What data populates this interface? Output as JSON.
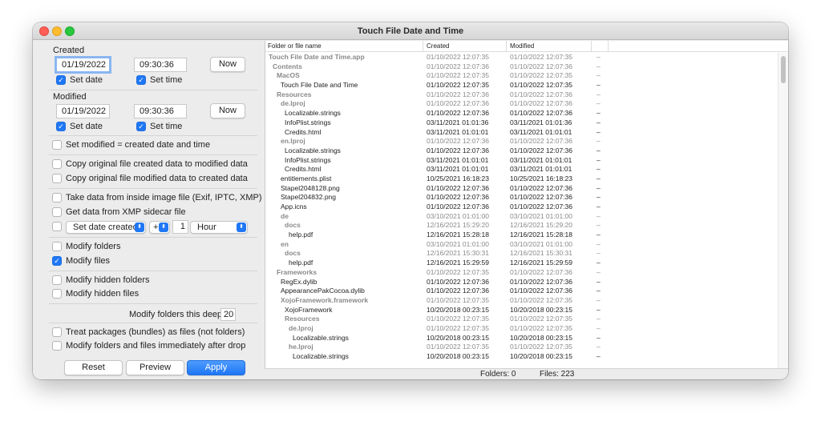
{
  "window": {
    "title": "Touch File Date and Time"
  },
  "created": {
    "label": "Created",
    "date": "01/19/2022",
    "time": "09:30:36",
    "now_label": "Now",
    "set_date_label": "Set date",
    "set_time_label": "Set time"
  },
  "modified": {
    "label": "Modified",
    "date": "01/19/2022",
    "time": "09:30:36",
    "now_label": "Now",
    "set_date_label": "Set date",
    "set_time_label": "Set time"
  },
  "options": {
    "set_mod_eq_created": "Set modified = created date and time",
    "copy_created_to_mod": "Copy original file created data to modified data",
    "copy_mod_to_created": "Copy original file modified data to created data",
    "take_from_image": "Take data from inside image file (Exif, IPTC, XMP)",
    "get_from_xmp": "Get data from XMP sidecar file",
    "offset_mode": "Set date created",
    "offset_sign": "+",
    "offset_amount": "1",
    "offset_unit": "Hour",
    "modify_folders": "Modify folders",
    "modify_files": "Modify files",
    "modify_hidden_folders": "Modify hidden folders",
    "modify_hidden_files": "Modify hidden files",
    "depth_label": "Modify folders this deep:",
    "depth_value": "20",
    "treat_packages": "Treat packages (bundles) as files (not folders)",
    "modify_after_drop": "Modify folders and files immediately after drop"
  },
  "buttons": {
    "reset": "Reset",
    "preview": "Preview",
    "apply": "Apply"
  },
  "table": {
    "headers": [
      "Folder or file name",
      "Created",
      "Modified"
    ],
    "rows": [
      [
        "Touch File Date and Time.app",
        "01/10/2022  12:07:35",
        "01/10/2022  12:07:35",
        "dim folder",
        0
      ],
      [
        "Contents",
        "01/10/2022  12:07:36",
        "01/10/2022  12:07:36",
        "dim folder",
        1
      ],
      [
        "MacOS",
        "01/10/2022  12:07:35",
        "01/10/2022  12:07:35",
        "dim folder",
        2
      ],
      [
        "Touch File Date and Time",
        "01/10/2022  12:07:35",
        "01/10/2022  12:07:35",
        "",
        3
      ],
      [
        "Resources",
        "01/10/2022  12:07:36",
        "01/10/2022  12:07:36",
        "dim folder",
        2
      ],
      [
        "de.lproj",
        "01/10/2022  12:07:36",
        "01/10/2022  12:07:36",
        "dim folder",
        3
      ],
      [
        "Localizable.strings",
        "01/10/2022  12:07:36",
        "01/10/2022  12:07:36",
        "",
        4
      ],
      [
        "InfoPlist.strings",
        "03/11/2021  01:01:36",
        "03/11/2021  01:01:36",
        "",
        4
      ],
      [
        "Credits.html",
        "03/11/2021  01:01:01",
        "03/11/2021  01:01:01",
        "",
        4
      ],
      [
        "en.lproj",
        "01/10/2022  12:07:36",
        "01/10/2022  12:07:36",
        "dim folder",
        3
      ],
      [
        "Localizable.strings",
        "01/10/2022  12:07:36",
        "01/10/2022  12:07:36",
        "",
        4
      ],
      [
        "InfoPlist.strings",
        "03/11/2021  01:01:01",
        "03/11/2021  01:01:01",
        "",
        4
      ],
      [
        "Credits.html",
        "03/11/2021  01:01:01",
        "03/11/2021  01:01:01",
        "",
        4
      ],
      [
        "entitlements.plist",
        "10/25/2021  16:18:23",
        "10/25/2021  16:18:23",
        "",
        3
      ],
      [
        "Stapel2048128.png",
        "01/10/2022  12:07:36",
        "01/10/2022  12:07:36",
        "",
        3
      ],
      [
        "Stapel204832.png",
        "01/10/2022  12:07:36",
        "01/10/2022  12:07:36",
        "",
        3
      ],
      [
        "App.icns",
        "01/10/2022  12:07:36",
        "01/10/2022  12:07:36",
        "",
        3
      ],
      [
        "de",
        "03/10/2021  01:01:00",
        "03/10/2021  01:01:00",
        "dim folder",
        3
      ],
      [
        "docs",
        "12/16/2021  15:29:20",
        "12/16/2021  15:29:20",
        "dim folder",
        4
      ],
      [
        "help.pdf",
        "12/16/2021  15:28:18",
        "12/16/2021  15:28:18",
        "",
        5
      ],
      [
        "en",
        "03/10/2021  01:01:00",
        "03/10/2021  01:01:00",
        "dim folder",
        3
      ],
      [
        "docs",
        "12/16/2021  15:30:31",
        "12/16/2021  15:30:31",
        "dim folder",
        4
      ],
      [
        "help.pdf",
        "12/16/2021  15:29:59",
        "12/16/2021  15:29:59",
        "",
        5
      ],
      [
        "Frameworks",
        "01/10/2022  12:07:35",
        "01/10/2022  12:07:36",
        "dim folder",
        2
      ],
      [
        "RegEx.dylib",
        "01/10/2022  12:07:36",
        "01/10/2022  12:07:36",
        "",
        3
      ],
      [
        "AppearancePakCocoa.dylib",
        "01/10/2022  12:07:36",
        "01/10/2022  12:07:36",
        "",
        3
      ],
      [
        "XojoFramework.framework",
        "01/10/2022  12:07:35",
        "01/10/2022  12:07:35",
        "dim folder",
        3
      ],
      [
        "XojoFramework",
        "10/20/2018  00:23:15",
        "10/20/2018  00:23:15",
        "",
        4
      ],
      [
        "Resources",
        "01/10/2022  12:07:35",
        "01/10/2022  12:07:35",
        "dim folder",
        4
      ],
      [
        "de.lproj",
        "01/10/2022  12:07:35",
        "01/10/2022  12:07:35",
        "dim folder",
        5
      ],
      [
        "Localizable.strings",
        "10/20/2018  00:23:15",
        "10/20/2018  00:23:15",
        "",
        6
      ],
      [
        "he.lproj",
        "01/10/2022  12:07:35",
        "01/10/2022  12:07:35",
        "dim folder",
        5
      ],
      [
        "Localizable.strings",
        "10/20/2018  00:23:15",
        "10/20/2018  00:23:15",
        "",
        6
      ]
    ],
    "dash": "–"
  },
  "status": {
    "folders": "Folders:  0",
    "files": "Files: 223"
  }
}
